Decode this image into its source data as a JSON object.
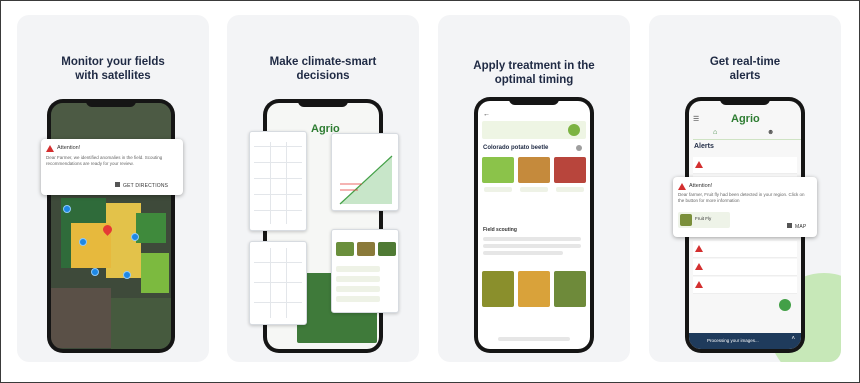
{
  "cards": [
    {
      "title_line1": "Monitor your fields",
      "title_line2": "with satellites",
      "alert": {
        "heading": "Attention!",
        "body": "Dear Farmer, we identified anomalies in the field. Scouting recommendations are ready for your review.",
        "action": "GET DIRECTIONS"
      }
    },
    {
      "title_line1": "Make climate-smart",
      "title_line2": "decisions",
      "brand": "Agrio"
    },
    {
      "title_line1": "Apply treatment in the",
      "title_line2": "optimal timing",
      "pest_title": "Colorado potato beetle",
      "section_title": "Field scouting"
    },
    {
      "title_line1": "Get real-time",
      "title_line2": "alerts",
      "brand": "Agrio",
      "alerts_header": "Alerts",
      "popup": {
        "heading": "Attention!",
        "body": "Dear farmer, Fruit fly had been detected in your region. Click on the button for more information",
        "tag": "Fruit Fly",
        "action": "MAP"
      },
      "status_bar": "Processing your images..."
    }
  ],
  "colors": {
    "title": "#1f2a44",
    "alert_red": "#d32f2f",
    "agrio_green": "#43a047",
    "card_bg": "#f3f4f6",
    "accent_blue": "#1e88e5"
  }
}
